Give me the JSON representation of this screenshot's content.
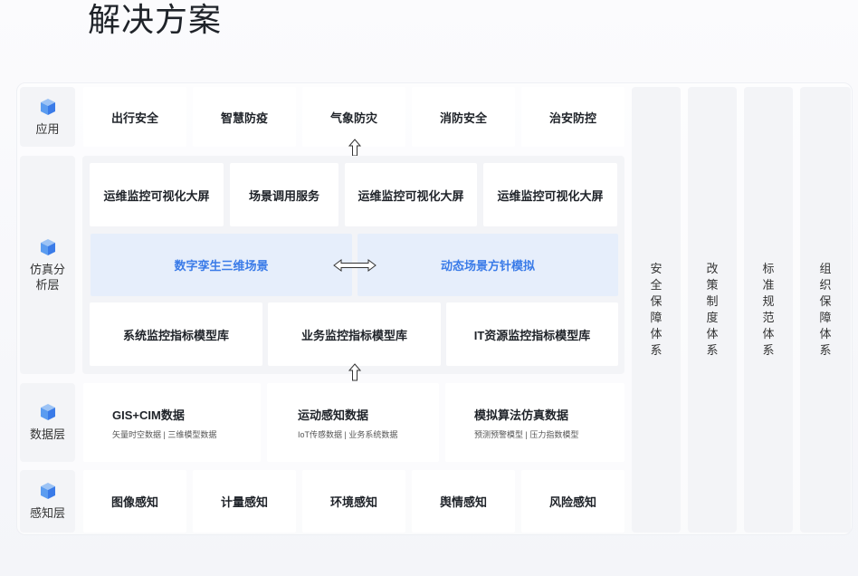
{
  "page": {
    "title": "解决方案"
  },
  "layers": {
    "app": {
      "label": "应用"
    },
    "sim": {
      "label": "仿真分析层"
    },
    "data": {
      "label": "数据层"
    },
    "sense": {
      "label": "感知层"
    }
  },
  "app_items": [
    "出行安全",
    "智慧防疫",
    "气象防灾",
    "消防安全",
    "治安防控"
  ],
  "sim_top": [
    "运维监控可视化大屏",
    "场景调用服务",
    "运维监控可视化大屏",
    "运维监控可视化大屏"
  ],
  "sim_mid": [
    "数字孪生三维场景",
    "动态场景方针模拟"
  ],
  "sim_bottom": [
    "系统监控指标模型库",
    "业务监控指标模型库",
    "IT资源监控指标模型库"
  ],
  "data_items": [
    {
      "title": "GIS+CIM数据",
      "sub": "矢量时空数据 | 三维模型数据"
    },
    {
      "title": "运动感知数据",
      "sub": "IoT传感数据 | 业务系统数据"
    },
    {
      "title": "模拟算法仿真数据",
      "sub": "预测预警模型 | 压力指数模型"
    }
  ],
  "sense_items": [
    "图像感知",
    "计量感知",
    "环境感知",
    "舆情感知",
    "风险感知"
  ],
  "systems": [
    "安全保障体系",
    "改策制度体系",
    "标准规范体系",
    "组织保障体系"
  ],
  "colors": {
    "accent": "#3a7be8",
    "panel": "#f3f4f7",
    "highlight": "#e6eefb"
  },
  "icons": {
    "layer": "cube-icon",
    "flow_up": "arrow-up-icon",
    "exchange": "double-arrow-icon"
  }
}
